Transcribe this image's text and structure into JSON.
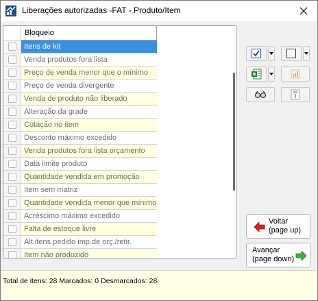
{
  "window": {
    "title": "Liberações autorizadas -FAT - Produto/Item"
  },
  "grid": {
    "column_header": "Bloqueio",
    "rows": [
      {
        "label": "Itens de kit",
        "state": "selected"
      },
      {
        "label": "Venda produtos fora lista",
        "state": "normal"
      },
      {
        "label": "Preço de venda menor que o mínimo",
        "state": "alt"
      },
      {
        "label": "Preço de venda divergente",
        "state": "normal"
      },
      {
        "label": "Venda de produto não liberado",
        "state": "alt"
      },
      {
        "label": "Alteração da grade",
        "state": "normal"
      },
      {
        "label": "Cotação no item",
        "state": "alt"
      },
      {
        "label": "Desconto máximo excedido",
        "state": "normal"
      },
      {
        "label": "Venda produtos fora lista orçamento",
        "state": "alt"
      },
      {
        "label": "Data limite produto",
        "state": "normal"
      },
      {
        "label": "Quantidade vendida em promoção",
        "state": "alt"
      },
      {
        "label": "Item sem matriz",
        "state": "normal"
      },
      {
        "label": "Quantidade vendida menor que mínimo",
        "state": "alt"
      },
      {
        "label": "Acréscimo máximo excedido",
        "state": "normal"
      },
      {
        "label": "Falta de estoque livre",
        "state": "alt"
      },
      {
        "label": "Alt.itens pedido imp.de orç./retir.",
        "state": "normal"
      },
      {
        "label": "Item não produzido",
        "state": "alt"
      }
    ]
  },
  "toolbar": {
    "icons": [
      "check-all-icon",
      "uncheck-all-icon",
      "excel-export-icon",
      "report-icon",
      "view-glasses-icon",
      "info-icon"
    ]
  },
  "nav": {
    "back_line1": "Voltar",
    "back_line2": "(page up)",
    "forward_line1": "Avançar",
    "forward_line2": "(page down)"
  },
  "status": {
    "summary": "Total de itens: 28 Marcados: 0 Desmarcados: 28"
  },
  "colors": {
    "selection": "#3b8fde",
    "alt_row": "#ffffe0",
    "status_bg": "#ffffe6",
    "back_arrow": "#e02424",
    "forward_arrow": "#3ab53a"
  }
}
